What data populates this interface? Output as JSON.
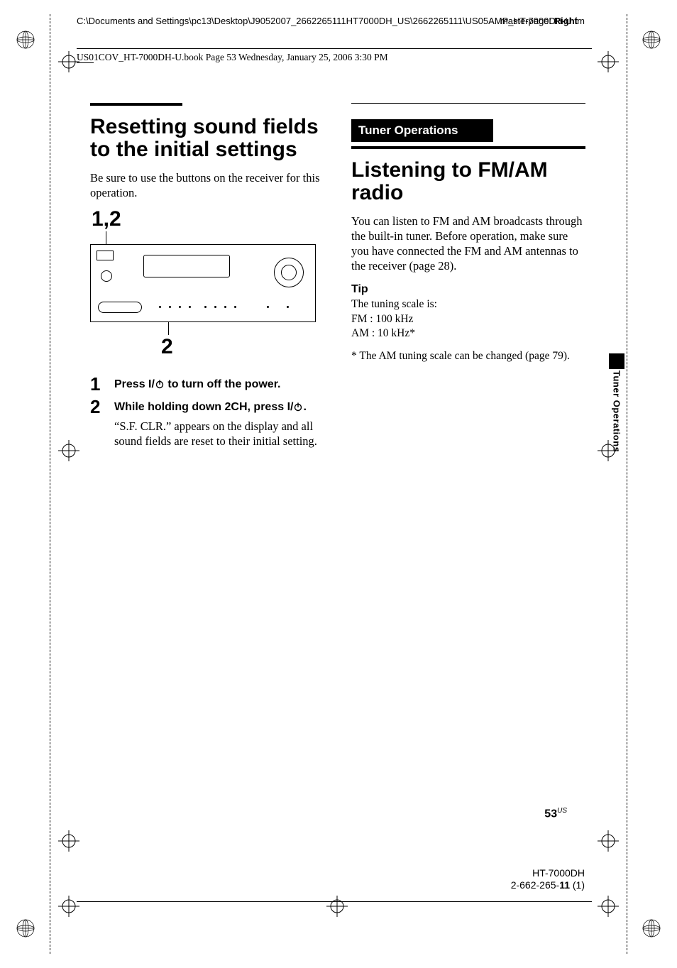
{
  "header": {
    "path": "C:\\Documents and Settings\\pc13\\Desktop\\J9052007_2662265111HT7000DH_US\\2662265111\\US05AMP_HT-7000DH-U.fm",
    "masterpage_label": "masterpage:",
    "masterpage_value": "Right",
    "slug": "US01COV_HT-7000DH-U.book  Page 53  Wednesday, January 25, 2006  3:30 PM"
  },
  "left": {
    "title": "Resetting sound fields to the initial settings",
    "intro": "Be sure to use the buttons on the receiver for this operation.",
    "callout_top": "1,2",
    "callout_bottom": "2",
    "steps": [
      {
        "num": "1",
        "head_pre": "Press ",
        "head_key": "I/",
        "head_post": " to turn off the power."
      },
      {
        "num": "2",
        "head_pre": "While holding down 2CH, press ",
        "head_key": "I/",
        "head_post": ".",
        "desc": "“S.F. CLR.” appears on the display and all sound fields are reset to their initial setting."
      }
    ]
  },
  "right": {
    "section_band": "Tuner Operations",
    "title": "Listening to FM/AM radio",
    "intro": "You can listen to FM and AM broadcasts through the built-in tuner. Before operation, make sure you have connected the FM and AM antennas to the receiver (page 28).",
    "tip_head": "Tip",
    "tip_lines": [
      "The tuning scale is:",
      "FM :  100 kHz",
      "AM :  10 kHz*"
    ],
    "footnote": "* The AM tuning scale can be changed (page 79)."
  },
  "side_tab": "Tuner Operations",
  "page_number": "53",
  "page_number_region": "US",
  "model": "HT-7000DH",
  "partno_pre": "2-662-265-",
  "partno_bold": "11",
  "partno_post": " (1)"
}
